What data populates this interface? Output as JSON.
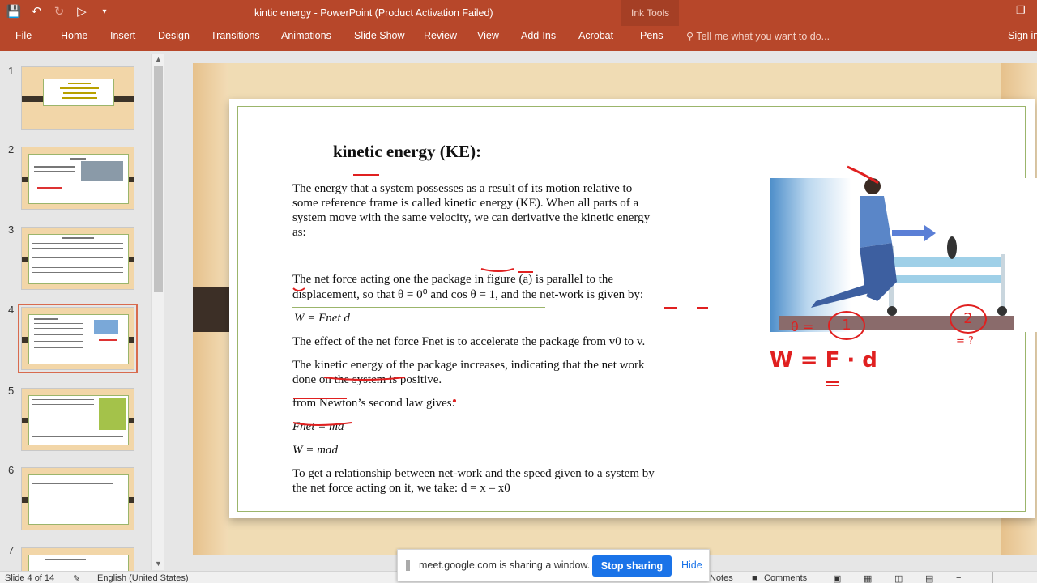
{
  "app": {
    "window_title": "kintic energy - PowerPoint (Product Activation Failed)",
    "contextual_group": "Ink Tools",
    "sign_in": "Sign in",
    "tell_me": "Tell me what you want to do..."
  },
  "ribbon": {
    "tabs": [
      "File",
      "Home",
      "Insert",
      "Design",
      "Transitions",
      "Animations",
      "Slide Show",
      "Review",
      "View",
      "Add-Ins",
      "Acrobat",
      "Pens"
    ]
  },
  "thumbnails": {
    "numbers": [
      "1",
      "2",
      "3",
      "4",
      "5",
      "6",
      "7"
    ],
    "selected": "4"
  },
  "slide": {
    "title": "kinetic energy (KE):",
    "para1": [
      " The energy that a system possesses as a result of its motion relative to",
      "some reference frame is called kinetic energy (KE). When all parts of a",
      "system move with the same velocity, we can derivative the kinetic energy",
      "as:"
    ],
    "para2": [
      "The net force acting one the package in figure (a) is parallel to the",
      "displacement, so that θ = 0⁰ and cos θ = 1, and the net-work is given by:"
    ],
    "eq_work": "W = Fnet d",
    "para3": "The effect of the net force Fnet is to accelerate the package from v0  to v.",
    "para4": [
      "The kinetic energy of the package increases, indicating that the net work",
      "done on the system is positive."
    ],
    "para5": "from Newton’s second law gives:",
    "eq_fnet": "Fnet = ma",
    "eq_w": "W = mad",
    "para6": [
      "To get a relationship between net-work and the speed given to a system by",
      "the net force acting on it, we take: d = x – x0"
    ],
    "ink": {
      "left_eq": "θ =",
      "circled_one": "1",
      "circled_two": "2",
      "question": "= ?",
      "w_eq": "W = F · d"
    }
  },
  "status": {
    "slide_info": "Slide 4 of 14",
    "language": "English (United States)",
    "notes": "Notes",
    "comments": "Comments"
  },
  "share_bar": {
    "message": "meet.google.com is sharing a window.",
    "stop_label": "Stop sharing",
    "hide_label": "Hide"
  }
}
